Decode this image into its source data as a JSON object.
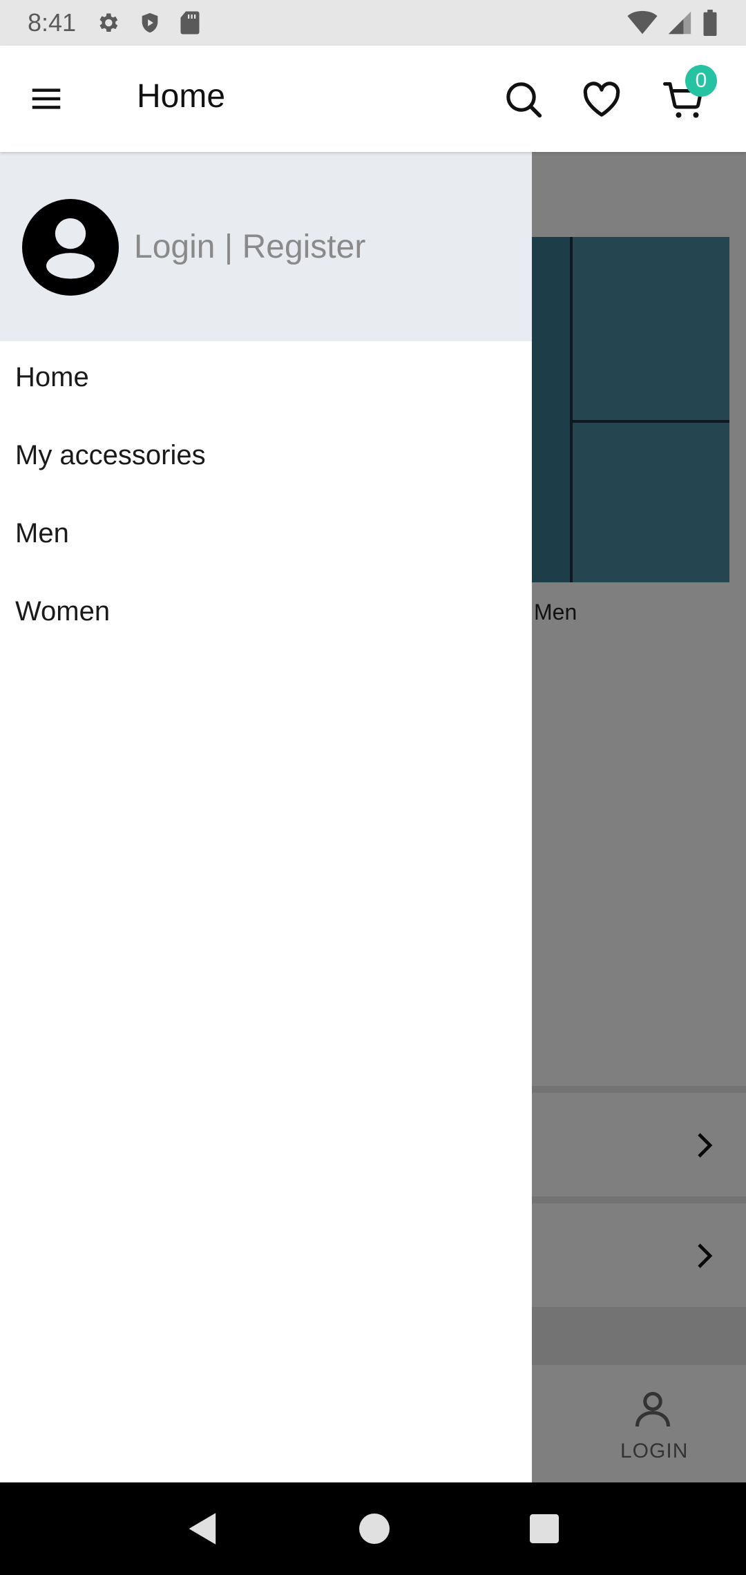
{
  "status_bar": {
    "time": "8:41",
    "icons_left": [
      "gear-icon",
      "shield-play-icon",
      "sd-card-icon"
    ],
    "icons_right": [
      "wifi-icon",
      "signal-icon",
      "battery-icon"
    ]
  },
  "app_bar": {
    "title": "Home",
    "menu_icon": "hamburger-menu-icon",
    "search_icon": "search-icon",
    "favorite_icon": "heart-icon",
    "cart_icon": "cart-icon",
    "cart_count": "0",
    "badge_color": "#26c3a3"
  },
  "drawer": {
    "header": {
      "avatar_icon": "account-circle-icon",
      "login_text": "Login | Register"
    },
    "items": [
      {
        "label": "Home"
      },
      {
        "label": "My accessories"
      },
      {
        "label": "Men"
      },
      {
        "label": "Women"
      }
    ]
  },
  "background": {
    "category_label": "Men",
    "bottom_nav_login_label": "LOGIN"
  },
  "nav_bar": {
    "icons": [
      "back-icon",
      "home-icon",
      "recents-icon"
    ]
  }
}
